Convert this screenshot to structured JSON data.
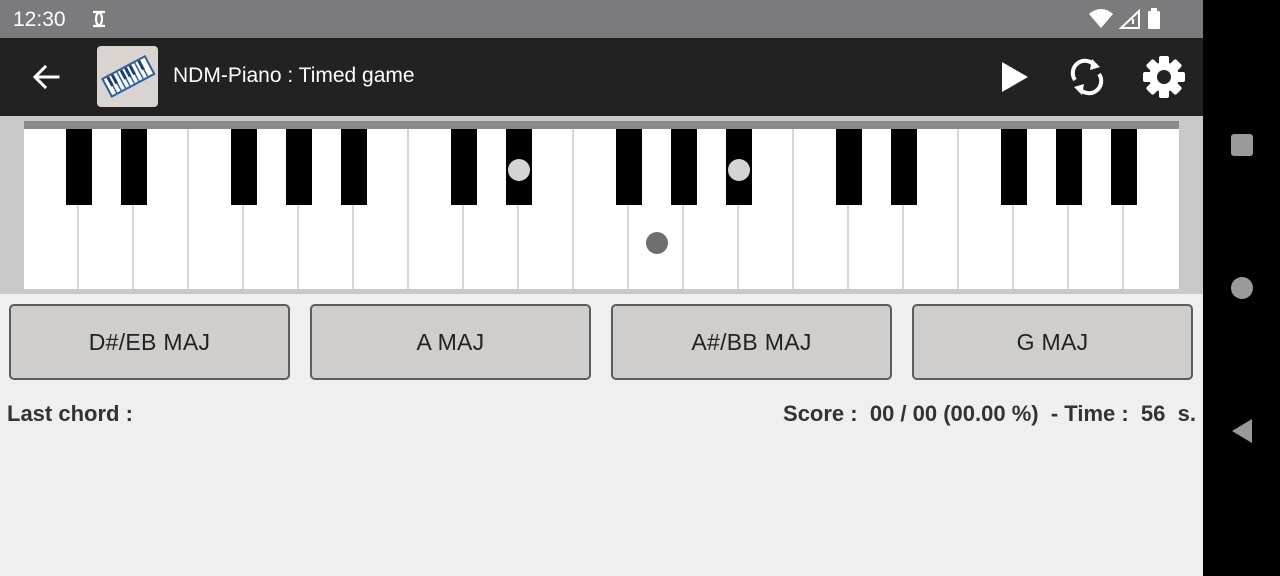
{
  "status_bar": {
    "time": "12:30"
  },
  "app_bar": {
    "title": "NDM-Piano : Timed game",
    "icons": [
      "back-arrow-icon",
      "app-logo",
      "play-icon",
      "refresh-icon",
      "settings-icon"
    ]
  },
  "keyboard": {
    "white_key_count": 21,
    "colors": {
      "white": "#ffffff",
      "black": "#000000",
      "marker_light": "#d4d4d4",
      "marker_dark": "#6e6e6e"
    }
  },
  "answers": [
    "D#/EB MAJ",
    "A MAJ",
    "A#/BB MAJ",
    "G MAJ"
  ],
  "info": {
    "last_chord_label": "Last chord :",
    "score_label": "Score :",
    "score_value": "00 / 00 (00.00 %)",
    "time_label": "- Time :",
    "time_value": "56",
    "time_unit": "s."
  }
}
